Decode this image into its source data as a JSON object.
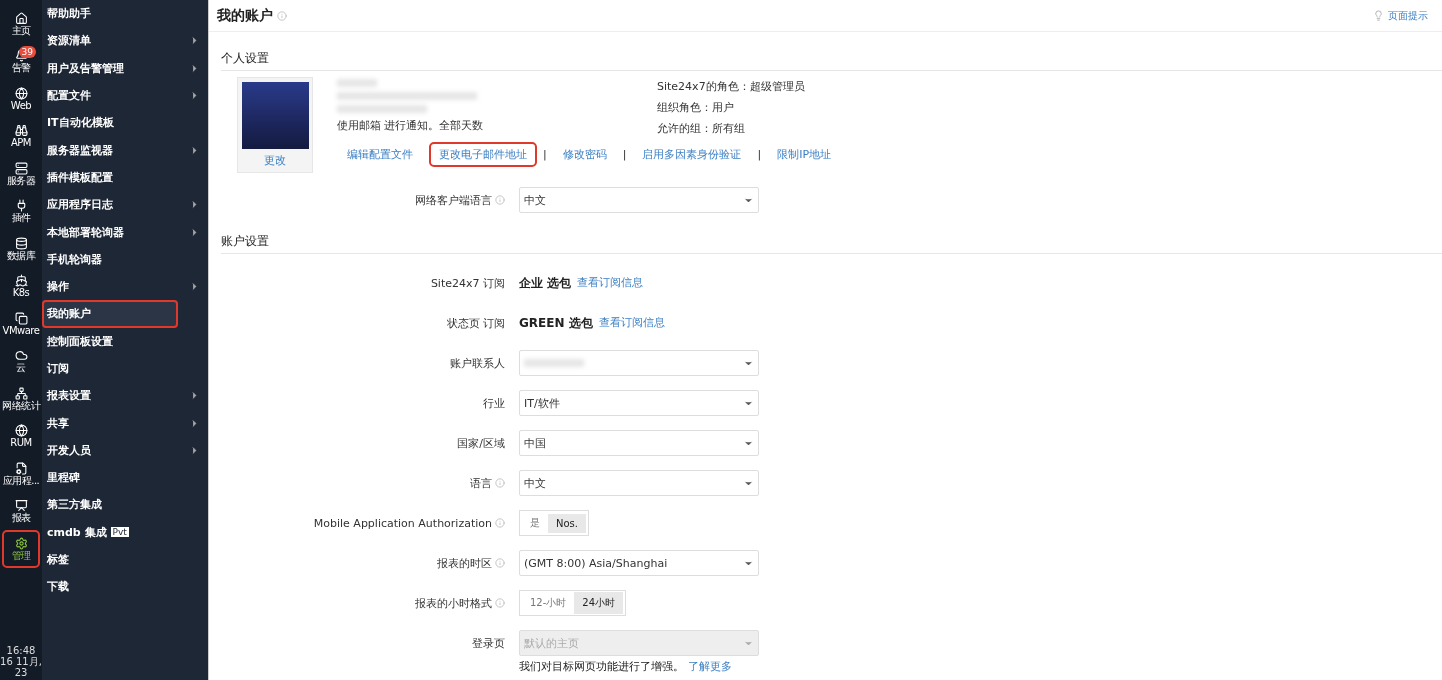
{
  "rail": {
    "items": [
      {
        "label": "主页",
        "selected": false,
        "highlighted": false
      },
      {
        "label": "告警",
        "badge": "39",
        "selected": false,
        "highlighted": false
      },
      {
        "label": "Web",
        "selected": false,
        "highlighted": false
      },
      {
        "label": "APM",
        "selected": false,
        "highlighted": false
      },
      {
        "label": "服务器",
        "selected": false,
        "highlighted": false
      },
      {
        "label": "插件",
        "selected": false,
        "highlighted": false
      },
      {
        "label": "数据库",
        "selected": false,
        "highlighted": false
      },
      {
        "label": "K8s",
        "selected": false,
        "highlighted": false
      },
      {
        "label": "VMware",
        "selected": false,
        "highlighted": false
      },
      {
        "label": "云",
        "selected": false,
        "highlighted": false
      },
      {
        "label": "网络统计",
        "selected": false,
        "highlighted": false
      },
      {
        "label": "RUM",
        "selected": false,
        "highlighted": false
      },
      {
        "label": "应用程...",
        "selected": false,
        "highlighted": false
      },
      {
        "label": "报表",
        "selected": false,
        "highlighted": false
      },
      {
        "label": "管理",
        "selected": true,
        "highlighted": true
      }
    ],
    "time": "16:48",
    "date": "16 11月,",
    "year": "23"
  },
  "menu": {
    "items": [
      {
        "label": "帮助助手",
        "submenu": false,
        "selected": false,
        "highlighted": false
      },
      {
        "label": "资源清单",
        "submenu": true,
        "selected": false,
        "highlighted": false
      },
      {
        "label": "用户及告警管理",
        "submenu": true,
        "selected": false,
        "highlighted": false
      },
      {
        "label": "配置文件",
        "submenu": true,
        "selected": false,
        "highlighted": false
      },
      {
        "label": "IT自动化模板",
        "submenu": false,
        "selected": false,
        "highlighted": false
      },
      {
        "label": "服务器监视器",
        "submenu": true,
        "selected": false,
        "highlighted": false
      },
      {
        "label": "插件模板配置",
        "submenu": false,
        "selected": false,
        "highlighted": false
      },
      {
        "label": "应用程序日志",
        "submenu": true,
        "selected": false,
        "highlighted": false
      },
      {
        "label": "本地部署轮询器",
        "submenu": true,
        "selected": false,
        "highlighted": false
      },
      {
        "label": "手机轮询器",
        "submenu": false,
        "selected": false,
        "highlighted": false
      },
      {
        "label": "操作",
        "submenu": true,
        "selected": false,
        "highlighted": false
      },
      {
        "label": "我的账户",
        "submenu": false,
        "selected": true,
        "highlighted": true
      },
      {
        "label": "控制面板设置",
        "submenu": false,
        "selected": false,
        "highlighted": false
      },
      {
        "label": "订阅",
        "submenu": false,
        "selected": false,
        "highlighted": false
      },
      {
        "label": "报表设置",
        "submenu": true,
        "selected": false,
        "highlighted": false
      },
      {
        "label": "共享",
        "submenu": true,
        "selected": false,
        "highlighted": false
      },
      {
        "label": "开发人员",
        "submenu": true,
        "selected": false,
        "highlighted": false
      },
      {
        "label": "里程碑",
        "submenu": false,
        "selected": false,
        "highlighted": false
      },
      {
        "label": "第三方集成",
        "submenu": false,
        "selected": false,
        "highlighted": false
      },
      {
        "label": "cmdb 集成",
        "tag": "Pvt",
        "submenu": false,
        "selected": false,
        "highlighted": false
      },
      {
        "label": "标签",
        "submenu": false,
        "selected": false,
        "highlighted": false
      },
      {
        "label": "下载",
        "submenu": false,
        "selected": false,
        "highlighted": false
      }
    ]
  },
  "header": {
    "title": "我的账户",
    "hint_link": "页面提示"
  },
  "personal": {
    "title": "个人设置",
    "avatar_action": "更改",
    "notify": "使用邮箱 进行通知。全部天数",
    "links": [
      {
        "label": "编辑配置文件",
        "highlighted": false
      },
      {
        "label": "更改电子邮件地址",
        "highlighted": true
      },
      {
        "separator": "|",
        "label": "修改密码",
        "highlighted": false
      },
      {
        "separator": "|",
        "label": "启用多因素身份验证",
        "highlighted": false
      },
      {
        "separator": "|",
        "label": "限制IP地址",
        "highlighted": false
      }
    ],
    "roles": [
      "Site24x7的角色：超级管理员",
      "组织角色：用户",
      "允许的组：所有组"
    ],
    "client_language": {
      "label": "网络客户端语言",
      "value": "中文"
    }
  },
  "account": {
    "title": "账户设置",
    "rows": [
      {
        "kind": "plan",
        "label": "Site24x7 订阅",
        "value": "企业 选包",
        "link": "查看订阅信息"
      },
      {
        "kind": "plan",
        "label": "状态页 订阅",
        "value": "GREEN 选包",
        "link": "查看订阅信息"
      },
      {
        "kind": "select",
        "label": "账户联系人",
        "redacted": true
      },
      {
        "kind": "select",
        "label": "行业",
        "value": "IT/软件"
      },
      {
        "kind": "select",
        "label": "国家/区域",
        "value": "中国"
      },
      {
        "kind": "select",
        "label": "语言",
        "info": true,
        "value": "中文"
      },
      {
        "kind": "toggle",
        "label": "Mobile Application Authorization",
        "info": true,
        "options": [
          {
            "label": "是",
            "selected": false
          },
          {
            "label": "Nos.",
            "selected": true
          }
        ]
      },
      {
        "kind": "select",
        "label": "报表的时区",
        "info": true,
        "value": "(GMT 8:00) Asia/Shanghai"
      },
      {
        "kind": "toggle",
        "label": "报表的小时格式",
        "info": true,
        "options": [
          {
            "label": "12-小时",
            "selected": false
          },
          {
            "label": "24小时",
            "selected": true
          }
        ]
      },
      {
        "kind": "select",
        "label": "登录页",
        "value": "默认的主页",
        "disabled": true,
        "note": "我们对目标网页功能进行了增强。",
        "note_link": "了解更多"
      }
    ]
  }
}
